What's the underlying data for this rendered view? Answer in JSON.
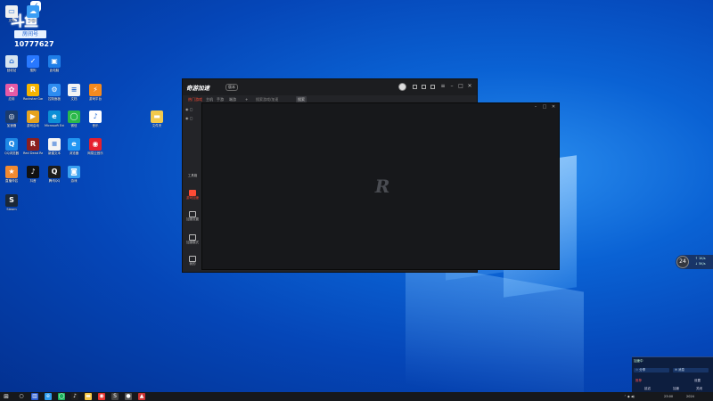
{
  "desktop": {
    "badge": {
      "title": "斗鱼",
      "label": "房间号",
      "number": "10777627"
    },
    "icons": [
      {
        "name": "recycle-bin-icon",
        "label": "回收站",
        "color": "#d7e4ef",
        "glyph": "⌂"
      },
      {
        "name": "sogou-icon",
        "label": "搜狗",
        "color": "#2878ff",
        "glyph": "✓"
      },
      {
        "name": "this-pc-icon",
        "label": "此电脑",
        "color": "#1e7ee8",
        "glyph": "▣"
      },
      {
        "name": "colorful-app-icon",
        "label": "应用",
        "color": "#e65aa6",
        "glyph": "✿"
      },
      {
        "name": "rockstar-icon",
        "label": "Rockstar Games",
        "color": "#f4b400",
        "glyph": "R"
      },
      {
        "name": "control-panel-icon",
        "label": "控制面板",
        "color": "#2d8cf0",
        "glyph": "⚙"
      },
      {
        "name": "document-icon",
        "label": "文档",
        "color": "#f3f3f3",
        "glyph": "≡"
      },
      {
        "name": "steam-client-icon",
        "label": "游戏平台",
        "color": "#f48a1e",
        "glyph": "⚡"
      },
      {
        "name": "speedtest-icon",
        "label": "加速器",
        "color": "#1b3b6e",
        "glyph": "◎"
      },
      {
        "name": "game-launcher-icon",
        "label": "游戏启动",
        "color": "#e6a21e",
        "glyph": "▶"
      },
      {
        "name": "edge-icon",
        "label": "Microsoft Edge",
        "color": "#0c8fd6",
        "glyph": "e"
      },
      {
        "name": "wechat-icon",
        "label": "微信",
        "color": "#2ab84a",
        "glyph": "◯"
      },
      {
        "name": "cloud-music-icon",
        "label": "音乐",
        "color": "#ffffff",
        "glyph": "♪"
      },
      {
        "name": "qqbrowser-icon",
        "label": "QQ浏览器",
        "color": "#1e88e5",
        "glyph": "Q"
      },
      {
        "name": "red-dead-icon",
        "label": "Red Dead Redemption",
        "color": "#8a1f1f",
        "glyph": "R"
      },
      {
        "name": "text-file-icon",
        "label": "新建文本",
        "color": "#f5f5f5",
        "glyph": "≡"
      },
      {
        "name": "ie-icon",
        "label": "浏览器",
        "color": "#2196f3",
        "glyph": "e"
      },
      {
        "name": "netease-music-icon",
        "label": "网易云音乐",
        "color": "#e5202e",
        "glyph": "◉"
      },
      {
        "name": "fox-app-icon",
        "label": "直播伴侣",
        "color": "#f28a30",
        "glyph": "★"
      },
      {
        "name": "tiktok-icon",
        "label": "抖音",
        "color": "#111111",
        "glyph": "♪"
      },
      {
        "name": "qq-icon",
        "label": "腾讯QQ",
        "color": "#1c1c1c",
        "glyph": "Q"
      },
      {
        "name": "arcade-icon",
        "label": "游戏",
        "color": "#39a0f0",
        "glyph": "◙"
      },
      {
        "name": "steam-icon",
        "label": "Steam",
        "color": "#1b2838",
        "glyph": "S"
      },
      {
        "name": "file-icon",
        "label": "文件",
        "color": "#f0f0f0",
        "glyph": "▭"
      },
      {
        "name": "cloud-drive-icon",
        "label": "网盘",
        "color": "#3a9df5",
        "glyph": "☁"
      },
      {
        "name": "folder-icon",
        "label": "文件夹",
        "color": "#f2c94c",
        "glyph": "▬"
      }
    ]
  },
  "app_window": {
    "logo": "奇游加速",
    "version": "版本",
    "tabs": [
      "热门游戏",
      "主机",
      "手游",
      "端游"
    ],
    "search_placeholder": "搜索游戏/加速",
    "search_button": "搜索",
    "sidebar": [
      {
        "label": "工具箱"
      },
      {
        "label": "游戏加速"
      },
      {
        "label": "加速设置"
      },
      {
        "label": "加速模式"
      },
      {
        "label": "我的"
      }
    ]
  },
  "game_window": {
    "logo": "R"
  },
  "float_widget": {
    "value": "24",
    "line1": "↑ 1K/s",
    "line2": "↓ 5K/s"
  },
  "notification": {
    "title": "加速中",
    "pill1": "☆ 分享",
    "pill2": "✉ 消息",
    "row1_left": "推荐",
    "row1_right": "设置",
    "row2_left": "延迟",
    "row2_mid": "加速",
    "row2_right": "关闭"
  },
  "taskbar": {
    "start": "⊞",
    "time": "23:00",
    "date": "2024"
  }
}
